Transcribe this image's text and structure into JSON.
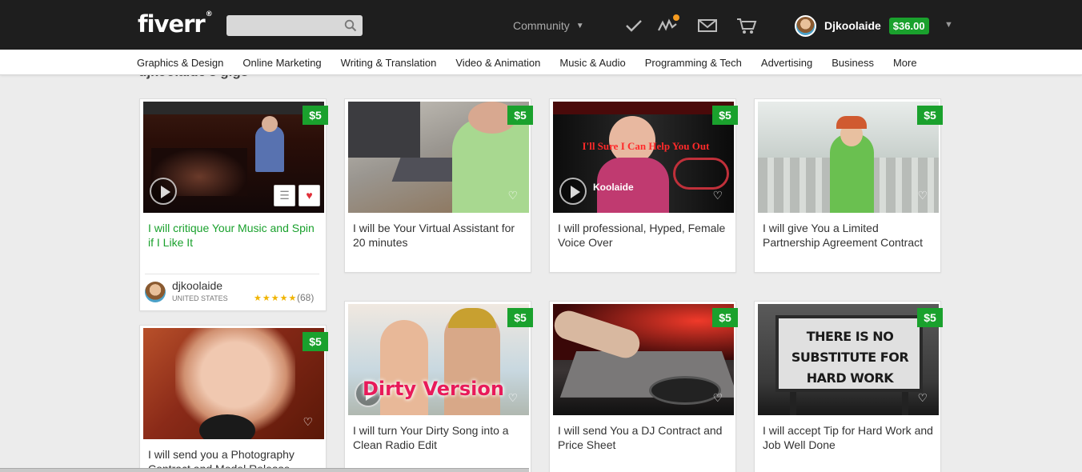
{
  "header": {
    "logo": "fiverr",
    "logo_mark": "®",
    "search_placeholder": "",
    "community_label": "Community",
    "username": "Djkoolaide",
    "balance": "$36.00"
  },
  "categories": [
    "Graphics & Design",
    "Online Marketing",
    "Writing & Translation",
    "Video & Animation",
    "Music & Audio",
    "Programming & Tech",
    "Advertising",
    "Business",
    "More"
  ],
  "section_title": "djkoolaide's gigs",
  "gigs": [
    {
      "title": "I will critique Your Music and Spin if I Like It",
      "price": "$5"
    },
    {
      "title": "I will be Your Virtual Assistant for 20 minutes",
      "price": "$5"
    },
    {
      "title": "I will professional, Hyped, Female Voice Over",
      "price": "$5"
    },
    {
      "title": "I will give You a Limited Partnership Agreement Contract",
      "price": "$5"
    },
    {
      "title": "I will send you a Photography Contract and Model Release",
      "price": "$5"
    },
    {
      "title": "I will turn Your Dirty Song into a Clean Radio Edit",
      "price": "$5"
    },
    {
      "title": "I will send You a DJ Contract and Price Sheet",
      "price": "$5"
    },
    {
      "title": "I will accept Tip for Hard Work and Job Well Done",
      "price": "$5"
    }
  ],
  "featured_seller": {
    "name": "djkoolaide",
    "country": "UNITED STATES",
    "stars": "★★★★★",
    "reviews": "(68)"
  },
  "thumb_texts": {
    "voice_brand": "Koolaide",
    "voice_tagline": "I'll Sure I Can Help You Out",
    "dirty": "Dirty Version",
    "sign": "THERE IS NO SUBSTITUTE FOR HARD WORK"
  },
  "icons": [
    "search-icon",
    "check-icon",
    "activity-icon",
    "mail-icon",
    "cart-icon",
    "heart-icon",
    "play-icon",
    "list-icon"
  ],
  "colors": {
    "topbar": "#1e1e1e",
    "accent": "#1aa12d",
    "notification": "#f59b20"
  }
}
